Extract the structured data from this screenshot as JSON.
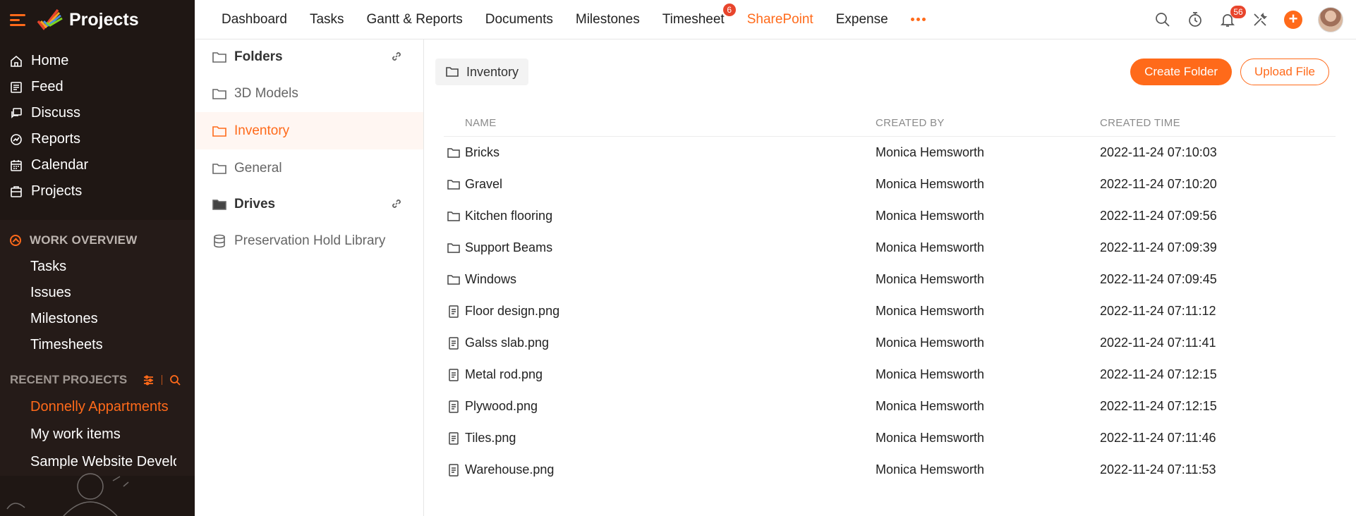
{
  "app": {
    "title": "Projects"
  },
  "sidebar": {
    "nav": [
      {
        "label": "Home",
        "icon": "home-icon"
      },
      {
        "label": "Feed",
        "icon": "feed-icon"
      },
      {
        "label": "Discuss",
        "icon": "discuss-icon"
      },
      {
        "label": "Reports",
        "icon": "reports-icon"
      },
      {
        "label": "Calendar",
        "icon": "calendar-icon"
      },
      {
        "label": "Projects",
        "icon": "projects-icon"
      }
    ],
    "work_overview": {
      "title": "WORK OVERVIEW",
      "items": [
        "Tasks",
        "Issues",
        "Milestones",
        "Timesheets"
      ]
    },
    "recent_projects": {
      "title": "RECENT PROJECTS",
      "items": [
        "Donnelly Appartments",
        "My work items",
        "Sample Website Develo"
      ]
    }
  },
  "topnav": {
    "items": [
      {
        "label": "Dashboard"
      },
      {
        "label": "Tasks"
      },
      {
        "label": "Gantt & Reports"
      },
      {
        "label": "Documents"
      },
      {
        "label": "Milestones"
      },
      {
        "label": "Timesheet",
        "badge": "6"
      },
      {
        "label": "SharePoint"
      },
      {
        "label": "Expense"
      }
    ],
    "notification_count": "56",
    "accent": "#ff6a1a"
  },
  "folders_panel": {
    "folders_title": "Folders",
    "folders": [
      "3D Models",
      "Inventory",
      "General"
    ],
    "drives_title": "Drives",
    "drives": [
      "Preservation Hold Library"
    ]
  },
  "main": {
    "breadcrumb": "Inventory",
    "create_folder": "Create Folder",
    "upload_file": "Upload File",
    "columns": [
      "NAME",
      "CREATED BY",
      "CREATED TIME"
    ],
    "rows": [
      {
        "type": "folder",
        "name": "Bricks",
        "created_by": "Monica Hemsworth",
        "created_time": "2022-11-24 07:10:03"
      },
      {
        "type": "folder",
        "name": "Gravel",
        "created_by": "Monica Hemsworth",
        "created_time": "2022-11-24 07:10:20"
      },
      {
        "type": "folder",
        "name": "Kitchen flooring",
        "created_by": "Monica Hemsworth",
        "created_time": "2022-11-24 07:09:56"
      },
      {
        "type": "folder",
        "name": "Support Beams",
        "created_by": "Monica Hemsworth",
        "created_time": "2022-11-24 07:09:39"
      },
      {
        "type": "folder",
        "name": "Windows",
        "created_by": "Monica Hemsworth",
        "created_time": "2022-11-24 07:09:45"
      },
      {
        "type": "file",
        "name": "Floor design.png",
        "created_by": "Monica Hemsworth",
        "created_time": "2022-11-24 07:11:12"
      },
      {
        "type": "file",
        "name": "Galss slab.png",
        "created_by": "Monica Hemsworth",
        "created_time": "2022-11-24 07:11:41"
      },
      {
        "type": "file",
        "name": "Metal rod.png",
        "created_by": "Monica Hemsworth",
        "created_time": "2022-11-24 07:12:15"
      },
      {
        "type": "file",
        "name": "Plywood.png",
        "created_by": "Monica Hemsworth",
        "created_time": "2022-11-24 07:12:15"
      },
      {
        "type": "file",
        "name": "Tiles.png",
        "created_by": "Monica Hemsworth",
        "created_time": "2022-11-24 07:11:46"
      },
      {
        "type": "file",
        "name": "Warehouse.png",
        "created_by": "Monica Hemsworth",
        "created_time": "2022-11-24 07:11:53"
      }
    ]
  }
}
